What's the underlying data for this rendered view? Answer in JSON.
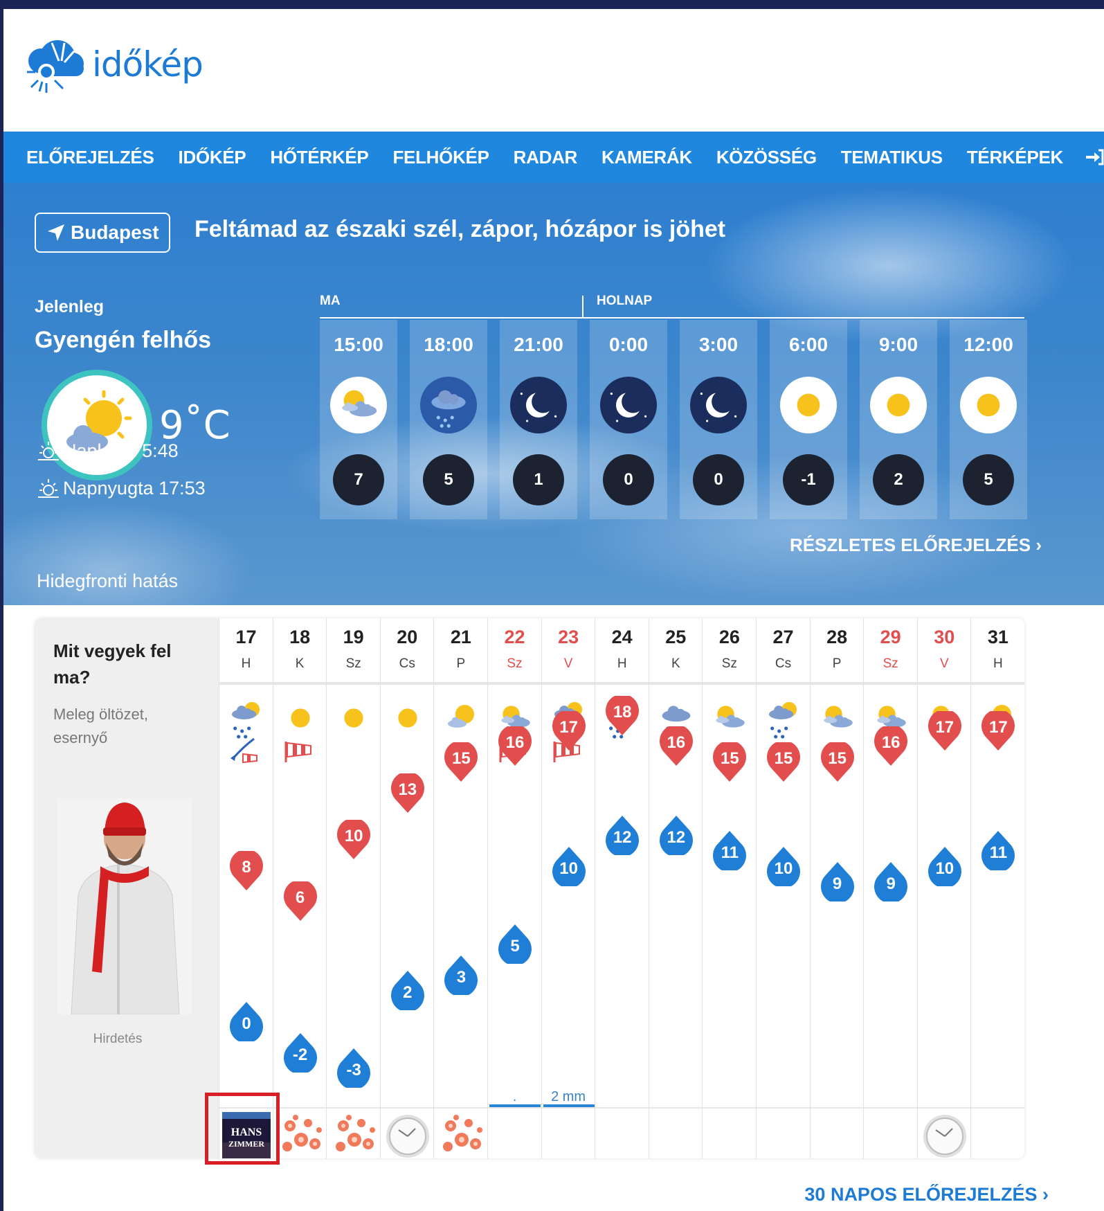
{
  "brand": {
    "name": "időkép"
  },
  "nav": {
    "items": [
      "ELŐREJELZÉS",
      "IDŐKÉP",
      "HŐTÉRKÉP",
      "FELHŐKÉP",
      "RADAR",
      "KAMERÁK",
      "KÖZÖSSÉG",
      "TEMATIKUS",
      "TÉRKÉPEK"
    ]
  },
  "hero": {
    "location": "Budapest",
    "headline": "Feltámad az északi szél, zápor, hózápor is jöhet",
    "current_label": "Jelenleg",
    "condition": "Gyengén felhős",
    "temperature": "9˚C",
    "sunrise": "Napkelte 5:48",
    "sunset": "Napnyugta 17:53",
    "effect": "Hidegfronti hatás",
    "today_label": "MA",
    "tomorrow_label": "HOLNAP",
    "detail_link": "RÉSZLETES ELŐREJELZÉS ›",
    "hourly": [
      {
        "time": "15:00",
        "icon": "partly-cloudy-icon",
        "temp": "7"
      },
      {
        "time": "18:00",
        "icon": "rain-cloud-icon",
        "temp": "5"
      },
      {
        "time": "21:00",
        "icon": "clear-night-icon",
        "temp": "1"
      },
      {
        "time": "0:00",
        "icon": "clear-night-icon",
        "temp": "0"
      },
      {
        "time": "3:00",
        "icon": "clear-night-icon",
        "temp": "0"
      },
      {
        "time": "6:00",
        "icon": "sunny-icon",
        "temp": "-1"
      },
      {
        "time": "9:00",
        "icon": "sunny-icon",
        "temp": "2"
      },
      {
        "time": "12:00",
        "icon": "sunny-icon",
        "temp": "5"
      }
    ]
  },
  "forecast": {
    "question": "Mit vegyek fel ma?",
    "advice": "Meleg öltözet, esernyő",
    "ad_label": "Hirdetés",
    "more_link": "30 NAPOS ELŐREJELZÉS ›",
    "days": [
      {
        "num": "17",
        "abbr": "H",
        "red": false,
        "icon": "rain-sun-icon",
        "wind": "storm",
        "max": 8,
        "min": 0,
        "precip": "",
        "extra": "hans-zimmer-ad"
      },
      {
        "num": "18",
        "abbr": "K",
        "red": false,
        "icon": "sunny-icon",
        "wind": "windsock",
        "max": 6,
        "min": -2,
        "precip": "",
        "extra": "flower-icon"
      },
      {
        "num": "19",
        "abbr": "Sz",
        "red": false,
        "icon": "sunny-icon",
        "wind": "",
        "max": 10,
        "min": -3,
        "precip": "",
        "extra": "flower-icon"
      },
      {
        "num": "20",
        "abbr": "Cs",
        "red": false,
        "icon": "sunny-icon",
        "wind": "",
        "max": 13,
        "min": 2,
        "precip": "",
        "extra": "clock-icon"
      },
      {
        "num": "21",
        "abbr": "P",
        "red": false,
        "icon": "mostly-sunny-icon",
        "wind": "",
        "max": 15,
        "min": 3,
        "precip": "",
        "extra": "flower-icon"
      },
      {
        "num": "22",
        "abbr": "Sz",
        "red": true,
        "icon": "partly-cloudy-icon",
        "wind": "windsock",
        "max": 16,
        "min": 5,
        "precip": ".",
        "extra": ""
      },
      {
        "num": "23",
        "abbr": "V",
        "red": true,
        "icon": "rain-sun-icon",
        "wind": "windsock",
        "max": 17,
        "min": 10,
        "precip": "2 mm",
        "extra": ""
      },
      {
        "num": "24",
        "abbr": "H",
        "red": false,
        "icon": "rain-sun-icon",
        "wind": "",
        "max": 18,
        "min": 12,
        "precip": "",
        "extra": ""
      },
      {
        "num": "25",
        "abbr": "K",
        "red": false,
        "icon": "rain-cloud-icon",
        "wind": "",
        "max": 16,
        "min": 12,
        "precip": "",
        "extra": ""
      },
      {
        "num": "26",
        "abbr": "Sz",
        "red": false,
        "icon": "partly-cloudy-icon",
        "wind": "",
        "max": 15,
        "min": 11,
        "precip": "",
        "extra": ""
      },
      {
        "num": "27",
        "abbr": "Cs",
        "red": false,
        "icon": "rain-sun-icon",
        "wind": "",
        "max": 15,
        "min": 10,
        "precip": "",
        "extra": ""
      },
      {
        "num": "28",
        "abbr": "P",
        "red": false,
        "icon": "partly-cloudy-icon",
        "wind": "",
        "max": 15,
        "min": 9,
        "precip": "",
        "extra": ""
      },
      {
        "num": "29",
        "abbr": "Sz",
        "red": true,
        "icon": "partly-cloudy-icon",
        "wind": "",
        "max": 16,
        "min": 9,
        "precip": "",
        "extra": ""
      },
      {
        "num": "30",
        "abbr": "V",
        "red": true,
        "icon": "partly-cloudy-icon",
        "wind": "",
        "max": 17,
        "min": 10,
        "precip": "",
        "extra": "clock-icon"
      },
      {
        "num": "31",
        "abbr": "H",
        "red": false,
        "icon": "mostly-sunny-icon",
        "wind": "",
        "max": 17,
        "min": 11,
        "precip": "",
        "extra": ""
      }
    ]
  },
  "colors": {
    "accent": "#1f87de",
    "max_pin": "#e24d4d",
    "min_pin": "#1f7fd6",
    "page_frame": "#1c2457"
  }
}
